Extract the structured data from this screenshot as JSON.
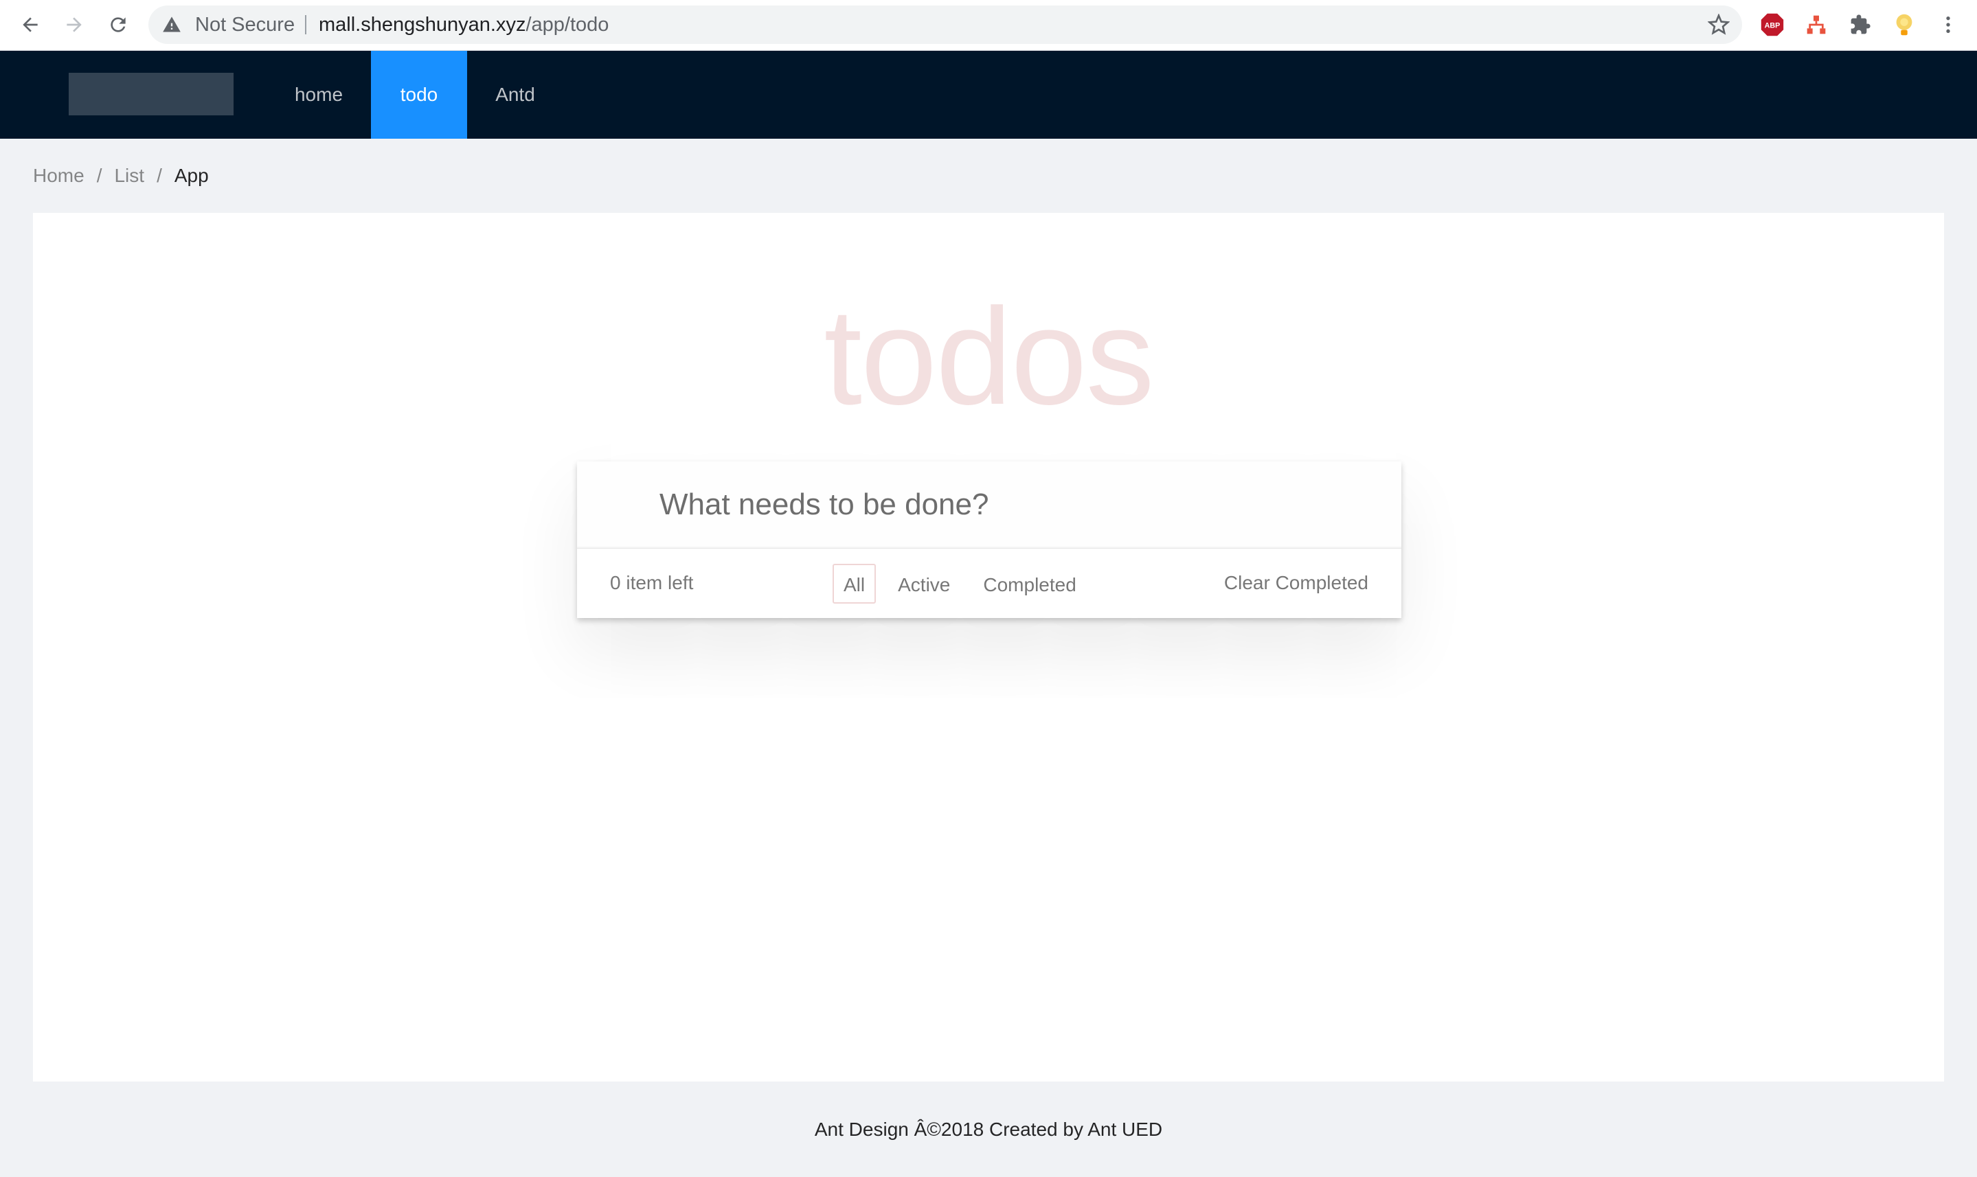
{
  "browser": {
    "security_label": "Not Secure",
    "url_host": "mall.shengshunyan.xyz",
    "url_path": "/app/todo"
  },
  "header": {
    "menu": [
      {
        "label": "home",
        "active": false
      },
      {
        "label": "todo",
        "active": true
      },
      {
        "label": "Antd",
        "active": false
      }
    ]
  },
  "breadcrumb": [
    "Home",
    "List",
    "App"
  ],
  "todo": {
    "title": "todos",
    "input_placeholder": "What needs to be done?",
    "count_text": "0 item left",
    "filters": [
      "All",
      "Active",
      "Completed"
    ],
    "selected_filter": "All",
    "clear_label": "Clear Completed"
  },
  "footer": {
    "text": "Ant Design Â©2018 Created by Ant UED"
  },
  "colors": {
    "header_bg": "#001529",
    "menu_active_bg": "#1890ff",
    "title_color": "rgba(175,47,47,0.15)"
  }
}
